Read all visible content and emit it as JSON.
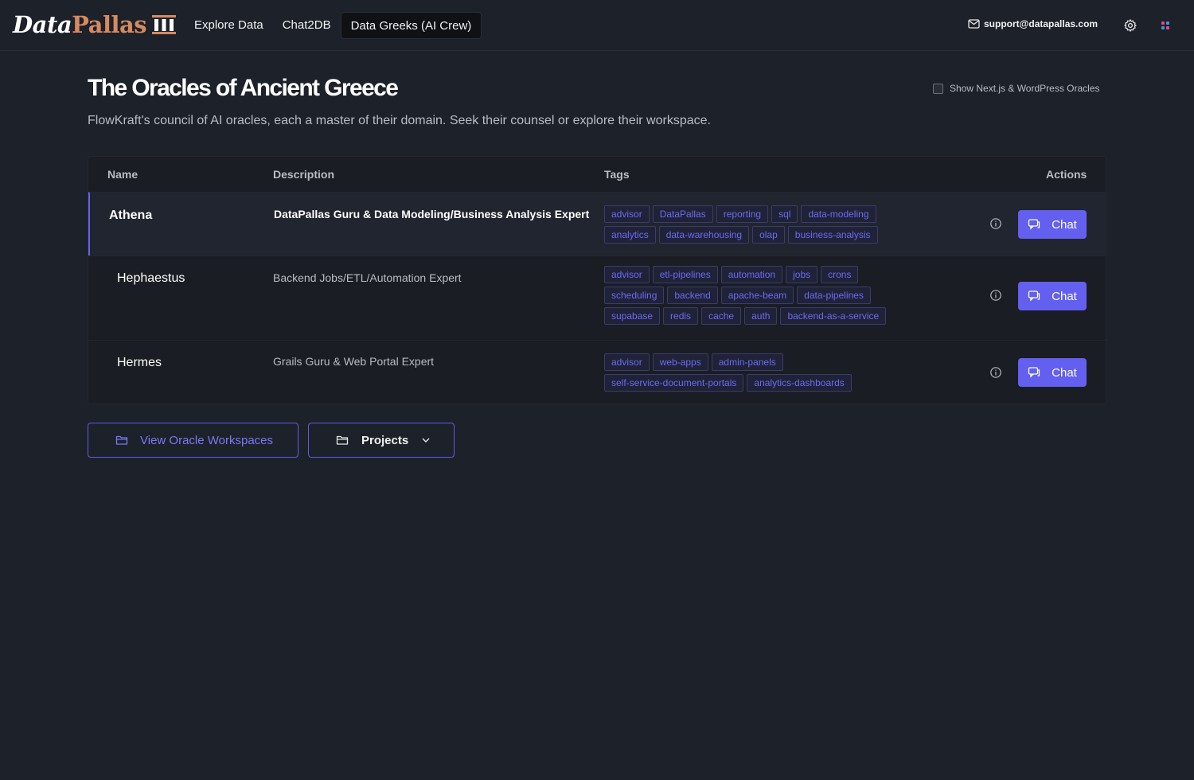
{
  "brand": {
    "logo_data": "Data",
    "logo_pallas": "Pallas"
  },
  "nav": [
    {
      "label": "Explore Data",
      "active": false
    },
    {
      "label": "Chat2DB",
      "active": false
    },
    {
      "label": "Data Greeks (AI Crew)",
      "active": true
    }
  ],
  "header_right": {
    "support_email": "support@datapallas.com"
  },
  "page": {
    "title": "The Oracles of Ancient Greece",
    "subtitle": "FlowKraft's council of AI oracles, each a master of their domain. Seek their counsel or explore their workspace.",
    "toggle_label": "Show Next.js & WordPress Oracles",
    "toggle_checked": false
  },
  "table": {
    "headers": {
      "name": "Name",
      "description": "Description",
      "tags": "Tags",
      "actions": "Actions"
    },
    "rows": [
      {
        "name": "Athena",
        "description": "DataPallas Guru & Data Modeling/Business Analysis Expert",
        "tags": [
          "advisor",
          "DataPallas",
          "reporting",
          "sql",
          "data-modeling",
          "analytics",
          "data-warehousing",
          "olap",
          "business-analysis"
        ],
        "chat_label": "Chat",
        "selected": true
      },
      {
        "name": "Hephaestus",
        "description": "Backend Jobs/ETL/Automation Expert",
        "tags": [
          "advisor",
          "etl-pipelines",
          "automation",
          "jobs",
          "crons",
          "scheduling",
          "backend",
          "apache-beam",
          "data-pipelines",
          "supabase",
          "redis",
          "cache",
          "auth",
          "backend-as-a-service"
        ],
        "chat_label": "Chat",
        "selected": false
      },
      {
        "name": "Hermes",
        "description": "Grails Guru & Web Portal Expert",
        "tags": [
          "advisor",
          "web-apps",
          "admin-panels",
          "self-service-document-portals",
          "analytics-dashboards"
        ],
        "chat_label": "Chat",
        "selected": false
      }
    ]
  },
  "buttons": {
    "workspaces": "View Oracle Workspaces",
    "projects": "Projects"
  },
  "colors": {
    "accent": "#6360f0",
    "background": "#1d2129",
    "logo_accent": "#d58a62"
  }
}
